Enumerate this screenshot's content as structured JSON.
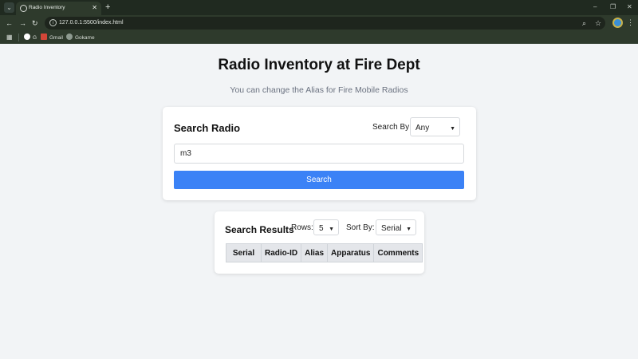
{
  "browser": {
    "tab_title": "Radio Inventory",
    "url": "127.0.0.1:5500/index.html",
    "bookmarks": [
      {
        "label": "G",
        "color": "#e8e8e8"
      },
      {
        "label": "Gmail",
        "color": "#d44638"
      },
      {
        "label": "Gokame",
        "color": "#8e9a90"
      }
    ]
  },
  "page": {
    "title": "Radio Inventory at Fire Dept",
    "subtitle": "You can change the Alias for Fire Mobile Radios"
  },
  "search": {
    "heading": "Search Radio",
    "search_by_label": "Search By:",
    "search_by_value": "Any",
    "input_value": "m3",
    "button_label": "Search"
  },
  "results": {
    "heading": "Search Results",
    "rows_label": "Rows:",
    "rows_value": "5",
    "sort_label": "Sort By:",
    "sort_value": "Serial",
    "columns": [
      "Serial",
      "Radio-ID",
      "Alias",
      "Apparatus",
      "Comments"
    ]
  },
  "colors": {
    "accent": "#3b82f6",
    "page_bg": "#f2f4f6"
  }
}
